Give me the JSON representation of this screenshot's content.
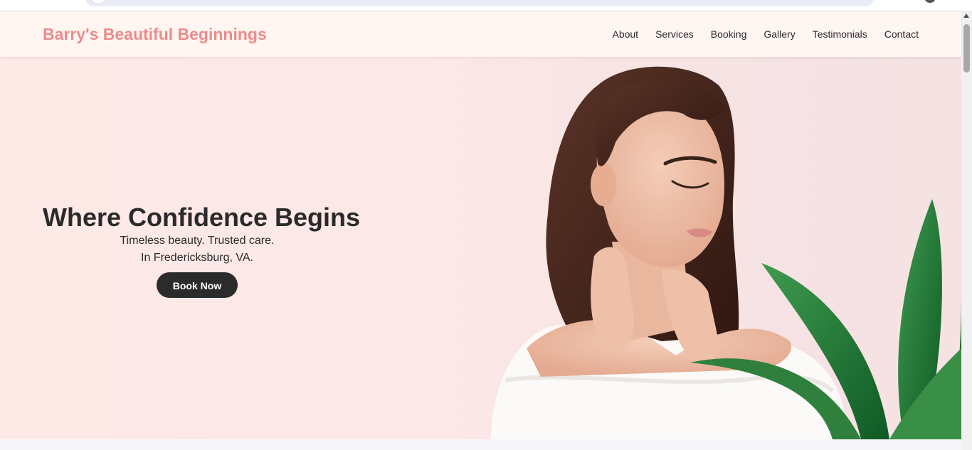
{
  "header": {
    "brand": "Barry's Beautiful Beginnings",
    "nav": [
      "About",
      "Services",
      "Booking",
      "Gallery",
      "Testimonials",
      "Contact"
    ]
  },
  "hero": {
    "title": "Where Confidence Begins",
    "subtitle_line1": "Timeless beauty. Trusted care.",
    "subtitle_line2": "In Fredericksburg, VA.",
    "cta": "Book Now"
  },
  "colors": {
    "brand": "#ee8a8a",
    "header_bg": "#fff6f2",
    "hero_bg": "#fde9e6",
    "button_bg": "#2b2b2b",
    "text": "#2a2a2a"
  },
  "icons": {
    "scroll_up": "scroll-up-arrow-icon"
  }
}
